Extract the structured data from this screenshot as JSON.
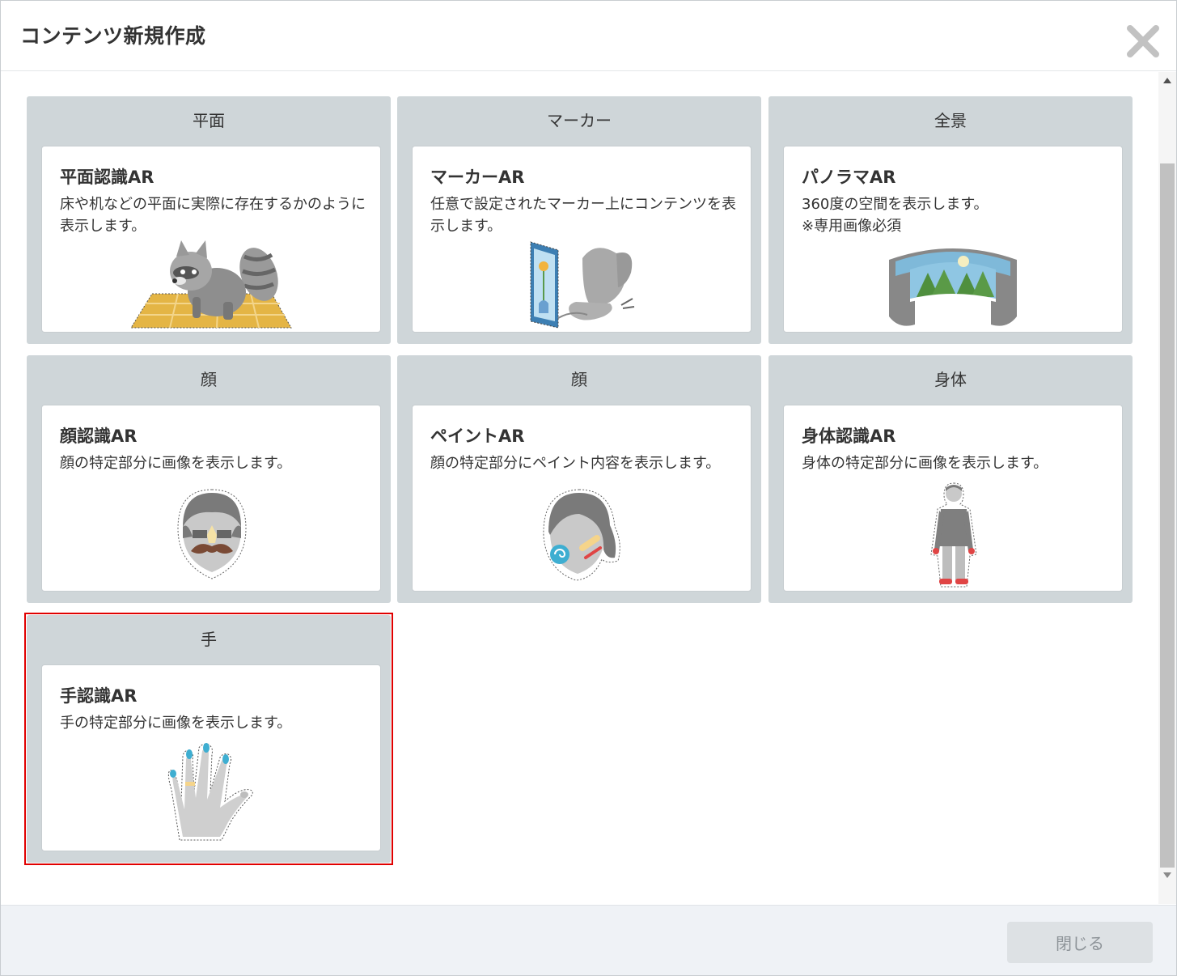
{
  "dialog": {
    "title": "コンテンツ新規作成",
    "close_button_label": "閉じる"
  },
  "groups": [
    {
      "label": "平面",
      "card": {
        "title": "平面認識AR",
        "description": "床や机などの平面に実際に存在するかのように表示します。",
        "illustration": "raccoon-on-floor-icon"
      }
    },
    {
      "label": "マーカー",
      "card": {
        "title": "マーカーAR",
        "description": "任意で設定されたマーカー上にコンテンツを表示します。",
        "illustration": "marker-butterfly-icon"
      }
    },
    {
      "label": "全景",
      "card": {
        "title": "パノラマAR",
        "description": "360度の空間を表示します。",
        "note": "※専用画像必須",
        "illustration": "panorama-icon"
      }
    },
    {
      "label": "顔",
      "card": {
        "title": "顔認識AR",
        "description": "顔の特定部分に画像を表示します。",
        "illustration": "face-mustache-icon"
      }
    },
    {
      "label": "顔",
      "card": {
        "title": "ペイントAR",
        "description": "顔の特定部分にペイント内容を表示します。",
        "illustration": "face-paint-icon"
      }
    },
    {
      "label": "身体",
      "card": {
        "title": "身体認識AR",
        "description": "身体の特定部分に画像を表示します。",
        "illustration": "body-icon"
      }
    },
    {
      "label": "手",
      "card": {
        "title": "手認識AR",
        "description": "手の特定部分に画像を表示します。",
        "illustration": "hand-icon"
      }
    }
  ],
  "selected_group_index": 6,
  "colors": {
    "group_bg": "#cfd6d9",
    "selection_border": "#e00000",
    "footer_bg": "#eff2f6"
  }
}
